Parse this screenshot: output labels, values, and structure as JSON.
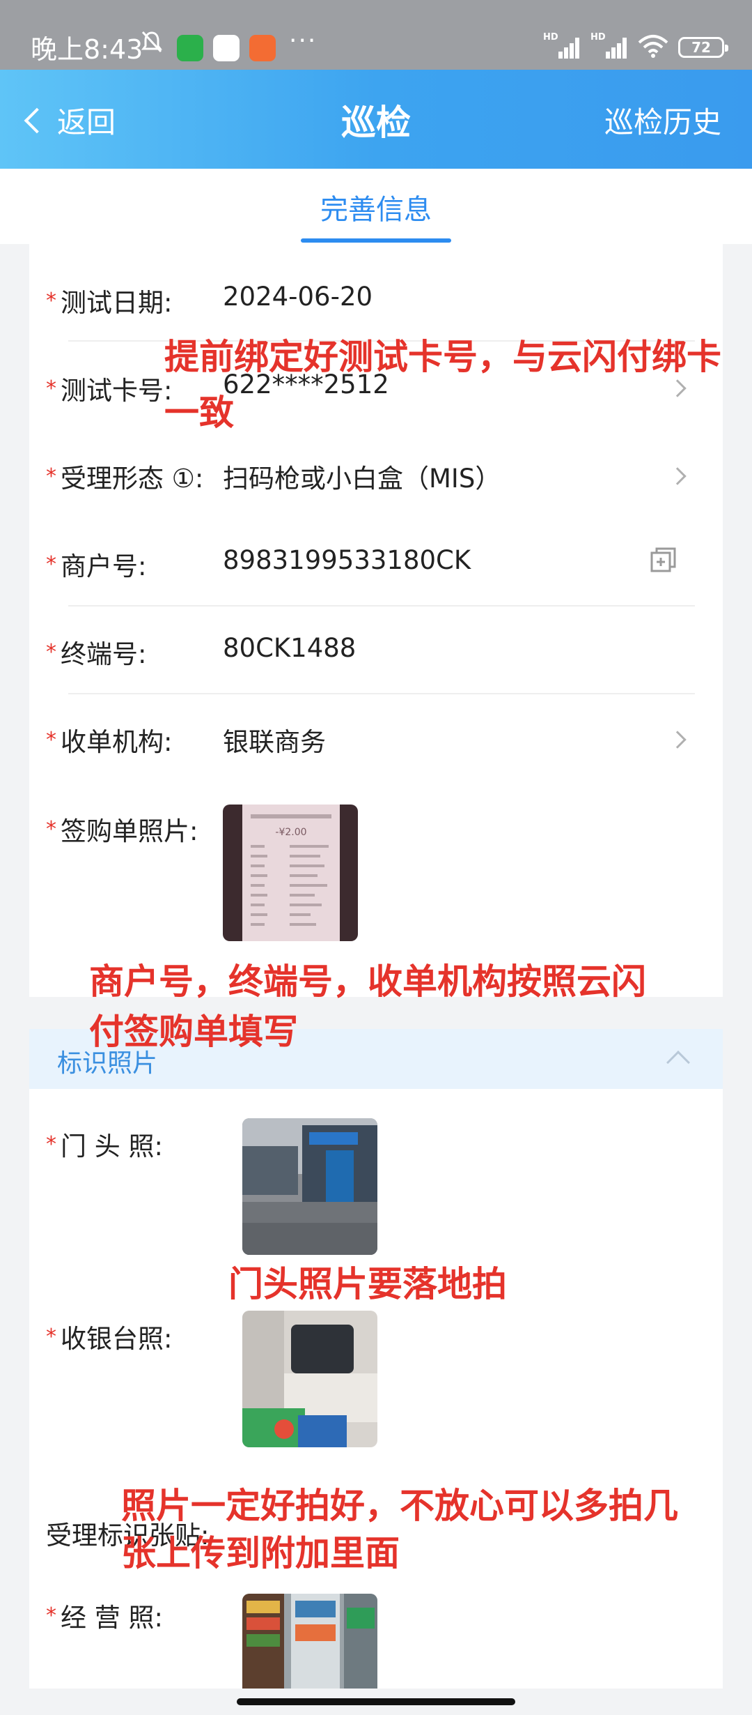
{
  "status_bar": {
    "time": "晚上8:43",
    "battery": "72",
    "network_1": "HD",
    "network_2": "HD",
    "more": "···"
  },
  "nav": {
    "back_label": "返回",
    "title": "巡检",
    "history_label": "巡检历史"
  },
  "tabs": [
    {
      "label": "完善信息",
      "active": true
    }
  ],
  "form": {
    "test_date": {
      "label": "测试日期:",
      "value": "2024-06-20"
    },
    "test_card": {
      "label": "测试卡号:",
      "value": "622****2512"
    },
    "accept_form": {
      "label": "受理形态 ①:",
      "value": "扫码枪或小白盒（MIS）"
    },
    "merchant_no": {
      "label": "商户号:",
      "value": "8983199533180CK"
    },
    "terminal_no": {
      "label": "终端号:",
      "value": "80CK1488"
    },
    "acquirer": {
      "label": "收单机构:",
      "value": "银联商务"
    },
    "receipt_photo": {
      "label": "签购单照片:",
      "receipt_amount": "-¥2.00"
    }
  },
  "section": {
    "title": "标识照片"
  },
  "photos": {
    "storefront": {
      "label": "门 头 照:"
    },
    "cashier": {
      "label": "收银台照:"
    },
    "sticker": {
      "label": "受理标识张贴:"
    },
    "business": {
      "label": "经 营 照:"
    }
  },
  "required_mark": "*",
  "annotations": {
    "card_note_1": "提前绑定好测试卡号，与云闪付绑卡",
    "card_note_2": "一致",
    "merchant_note_1": "商户号，终端号，收单机构按照云闪",
    "merchant_note_2": "付签购单填写",
    "storefront_note": "门头照片要落地拍",
    "photo_note_1": "照片一定好拍好，不放心可以多拍几",
    "photo_note_2": "张上传到附加里面"
  },
  "colors": {
    "accent": "#2d8cf0",
    "nav_gradient_start": "#5fc4f7",
    "required": "#e5332b",
    "annotation": "#e5332b"
  }
}
